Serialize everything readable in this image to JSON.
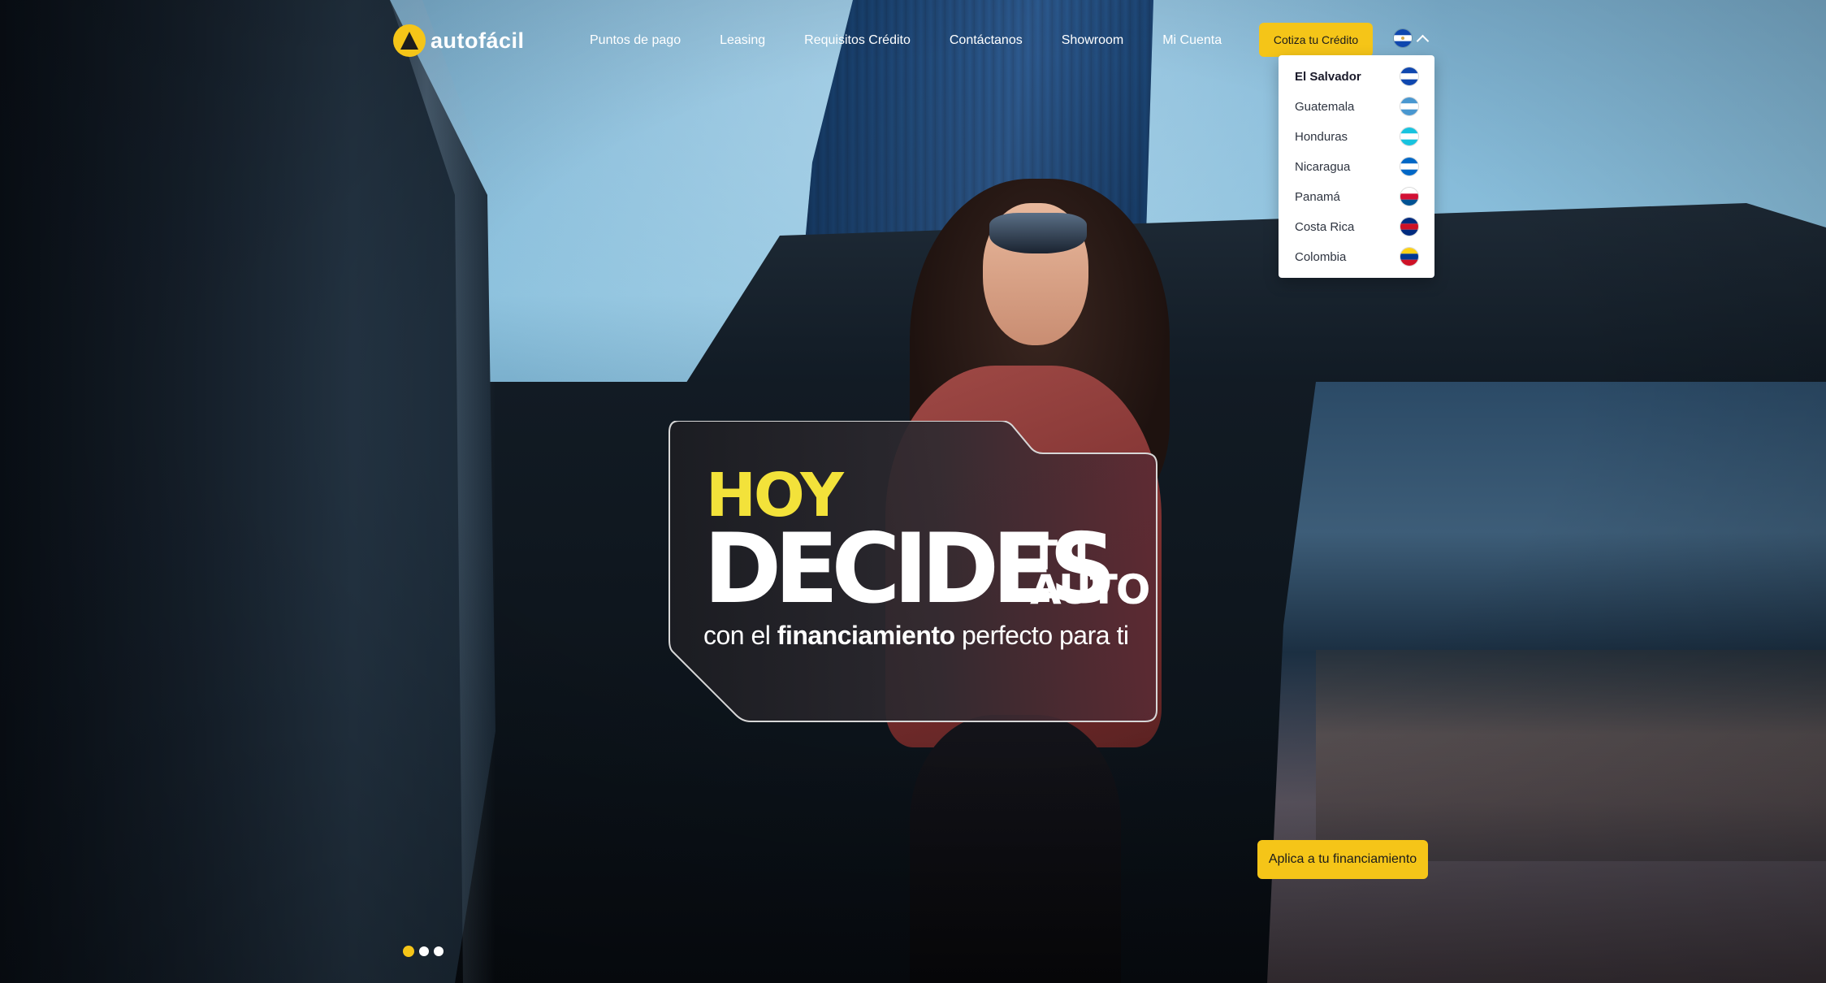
{
  "brand": {
    "logo_text": "autofácil"
  },
  "nav": {
    "items": [
      "Puntos de pago",
      "Leasing",
      "Requisitos Crédito",
      "Contáctanos",
      "Showroom",
      "Mi Cuenta"
    ],
    "cta_label": "Cotiza tu Crédito"
  },
  "country_selector": {
    "selected": "El Salvador",
    "options": [
      {
        "label": "El Salvador",
        "flag": "el-salvador-flag-icon",
        "colors": [
          "#0f47af",
          "#ffffff",
          "#0f47af"
        ]
      },
      {
        "label": "Guatemala",
        "flag": "guatemala-flag-icon",
        "colors": [
          "#4997d0",
          "#ffffff",
          "#4997d0"
        ]
      },
      {
        "label": "Honduras",
        "flag": "honduras-flag-icon",
        "colors": [
          "#18c3df",
          "#ffffff",
          "#18c3df"
        ]
      },
      {
        "label": "Nicaragua",
        "flag": "nicaragua-flag-icon",
        "colors": [
          "#0067c6",
          "#ffffff",
          "#0067c6"
        ]
      },
      {
        "label": "Panamá",
        "flag": "panama-flag-icon",
        "colors": [
          "#ffffff",
          "#d21034",
          "#005293"
        ]
      },
      {
        "label": "Costa Rica",
        "flag": "costa-rica-flag-icon",
        "colors": [
          "#002b7f",
          "#ce1126",
          "#002b7f"
        ]
      },
      {
        "label": "Colombia",
        "flag": "colombia-flag-icon",
        "colors": [
          "#fcd116",
          "#003893",
          "#ce1126"
        ]
      }
    ]
  },
  "hero": {
    "headline_hoy": "HOY",
    "headline_decides": "DECIDES",
    "headline_tu": "TU",
    "headline_auto": "AUTO",
    "sub_pre": "con el ",
    "sub_bold": "financiamiento",
    "sub_post": " perfecto para ti",
    "cta_label": "Aplica a tu financiamiento"
  },
  "carousel": {
    "slide_count": 3,
    "active_index": 0
  },
  "theme": {
    "accent": "#f5c518",
    "headline_yellow": "#f3e23a"
  }
}
